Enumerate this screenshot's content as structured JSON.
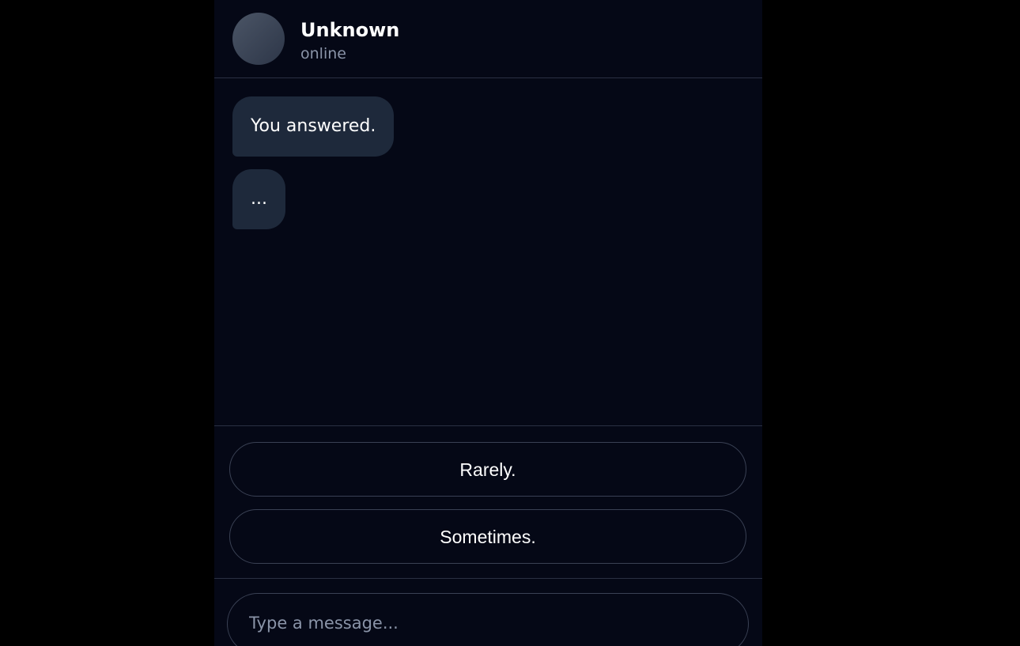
{
  "header": {
    "contact_name": "Unknown",
    "status": "online"
  },
  "messages": [
    {
      "text": "You answered."
    },
    {
      "text": "..."
    }
  ],
  "replies": [
    {
      "label": "Rarely."
    },
    {
      "label": "Sometimes."
    }
  ],
  "composer": {
    "placeholder": "Type a message..."
  },
  "colors": {
    "page_background": "#000000",
    "app_background": "#050816",
    "bubble_background": "#1e293b",
    "border": "#3a4154",
    "muted_text": "#8a94a8"
  }
}
